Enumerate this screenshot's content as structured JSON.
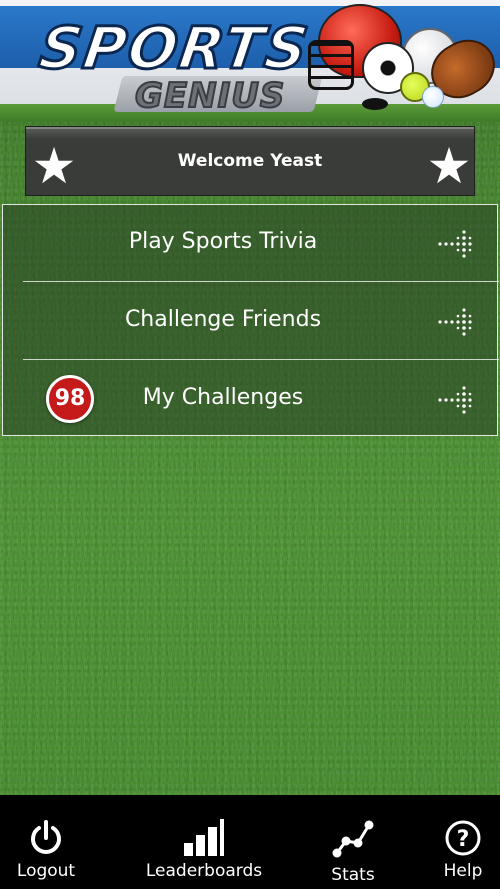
{
  "logo": {
    "line1": "SPORTS",
    "line2": "GENIUS"
  },
  "welcome": {
    "text": "Welcome Yeast"
  },
  "menu": {
    "items": [
      {
        "label": "Play Sports Trivia"
      },
      {
        "label": "Challenge Friends"
      },
      {
        "label": "My Challenges",
        "badge": "98"
      }
    ]
  },
  "tabbar": {
    "tabs": [
      {
        "label": "Logout",
        "icon": "power-icon"
      },
      {
        "label": "Leaderboards",
        "icon": "bar-chart-icon"
      },
      {
        "label": "Stats",
        "icon": "stats-graph-icon"
      },
      {
        "label": "Help",
        "icon": "help-icon"
      }
    ]
  },
  "colors": {
    "grass": "#4a8a33",
    "welcome_bar": "#3a3c39",
    "badge": "#c41a1a",
    "tabbar": "#000000",
    "logo_blue": "#1d5fab"
  }
}
